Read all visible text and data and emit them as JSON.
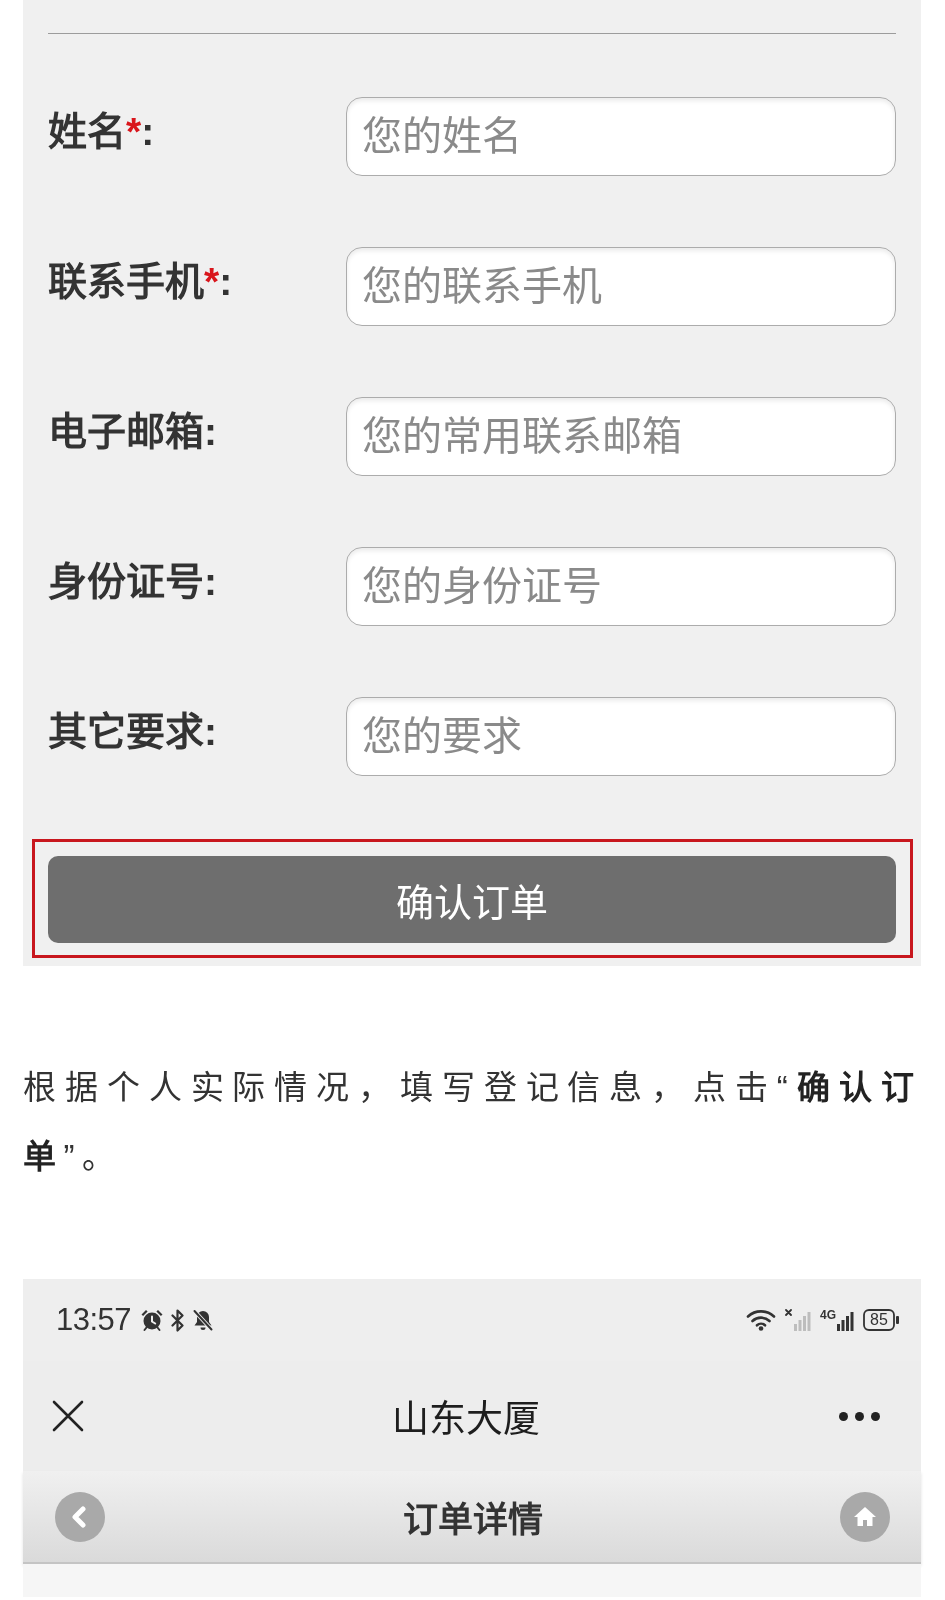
{
  "form": {
    "fields": [
      {
        "label": "姓名",
        "required_mark": "*",
        "colon": ":",
        "placeholder": "您的姓名"
      },
      {
        "label": "联系手机",
        "required_mark": "*",
        "colon": ":",
        "placeholder": "您的联系手机"
      },
      {
        "label": "电子邮箱",
        "colon": ":",
        "placeholder": "您的常用联系邮箱"
      },
      {
        "label": "身份证号",
        "colon": ":",
        "placeholder": "您的身份证号"
      },
      {
        "label": "其它要求",
        "colon": ":",
        "placeholder": "您的要求"
      }
    ],
    "submit": {
      "label": "确认订单",
      "highlighted": true
    }
  },
  "instruction": "根据个人实际情况，填写登记信息，点击“**确认订单**”。",
  "phone": {
    "status_bar": {
      "time": "13:57",
      "network": "4G",
      "battery": "85"
    },
    "title": "山东大厦",
    "subtitle": "订单详情"
  }
}
